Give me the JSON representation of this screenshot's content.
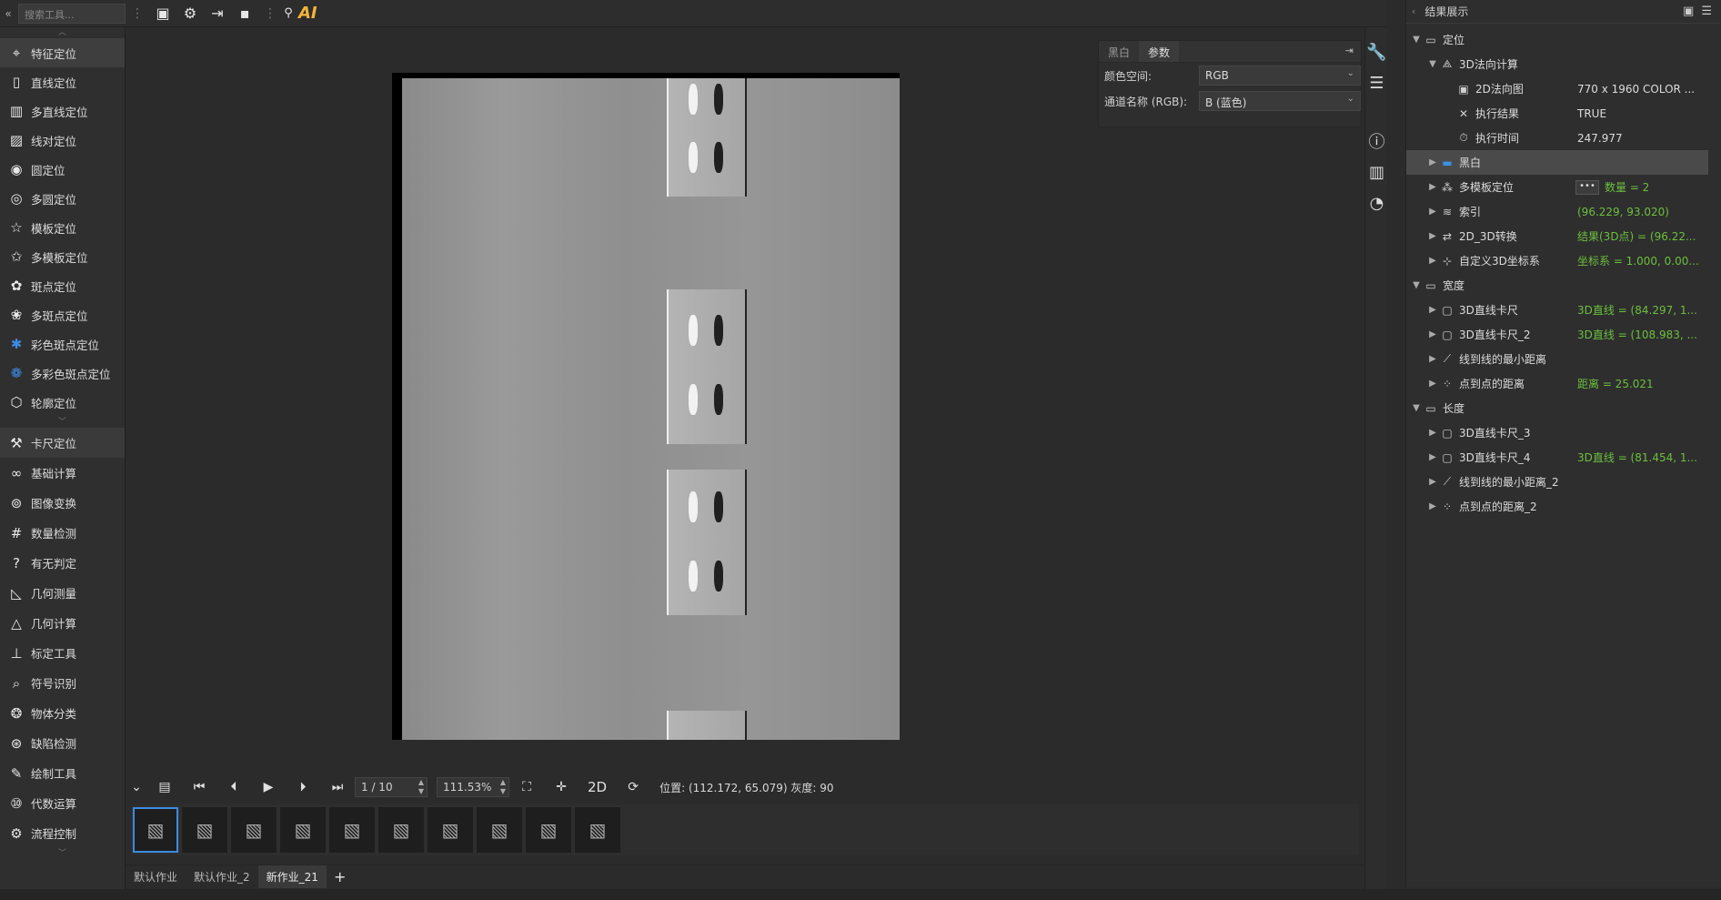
{
  "toolbar": {
    "search_placeholder": "搜索工具...",
    "ai_label": "AI"
  },
  "sidebar": {
    "tools": [
      {
        "label": "特征定位",
        "icon": "location-pin-icon"
      },
      {
        "label": "直线定位",
        "icon": "line-icon"
      },
      {
        "label": "多直线定位",
        "icon": "multi-line-icon"
      },
      {
        "label": "线对定位",
        "icon": "line-pair-icon"
      },
      {
        "label": "圆定位",
        "icon": "circle-icon"
      },
      {
        "label": "多圆定位",
        "icon": "multi-circle-icon"
      },
      {
        "label": "模板定位",
        "icon": "star-icon"
      },
      {
        "label": "多模板定位",
        "icon": "multi-star-icon"
      },
      {
        "label": "斑点定位",
        "icon": "blob-icon"
      },
      {
        "label": "多斑点定位",
        "icon": "multi-blob-icon"
      },
      {
        "label": "彩色斑点定位",
        "icon": "color-blob-icon"
      },
      {
        "label": "多彩色斑点定位",
        "icon": "multi-color-blob-icon"
      },
      {
        "label": "轮廓定位",
        "icon": "contour-icon"
      }
    ],
    "categories": [
      {
        "label": "卡尺定位",
        "icon": "caliper-icon"
      },
      {
        "label": "基础计算",
        "icon": "infinity-icon"
      },
      {
        "label": "图像变换",
        "icon": "transform-icon"
      },
      {
        "label": "数量检测",
        "icon": "count-icon"
      },
      {
        "label": "有无判定",
        "icon": "question-icon"
      },
      {
        "label": "几何测量",
        "icon": "measure-icon"
      },
      {
        "label": "几何计算",
        "icon": "geometry-icon"
      },
      {
        "label": "标定工具",
        "icon": "calibrate-icon"
      },
      {
        "label": "符号识别",
        "icon": "ocr-icon"
      },
      {
        "label": "物体分类",
        "icon": "brain-icon"
      },
      {
        "label": "缺陷检测",
        "icon": "defect-icon"
      },
      {
        "label": "绘制工具",
        "icon": "draw-icon"
      },
      {
        "label": "代数运算",
        "icon": "binary-icon"
      },
      {
        "label": "流程控制",
        "icon": "flow-icon"
      }
    ]
  },
  "params": {
    "tabs": [
      "黑白",
      "参数"
    ],
    "active_tab": 1,
    "rows": [
      {
        "label": "颜色空间:",
        "value": "RGB"
      },
      {
        "label": "通道名称 (RGB):",
        "value": "B (蓝色)"
      }
    ]
  },
  "playback": {
    "frame": "1 / 10",
    "zoom": "111.53%",
    "mode": "2D",
    "status": "位置: (112.172, 65.079)  灰度: 90"
  },
  "thumbnails_count": 10,
  "bottom_tabs": [
    "默认作业",
    "默认作业_2",
    "新作业_21"
  ],
  "active_bottom_tab": 2,
  "results": {
    "title": "结果展示",
    "tree": [
      {
        "level": 0,
        "arrow": "▼",
        "icon": "folder-icon",
        "label": "定位",
        "value": ""
      },
      {
        "level": 1,
        "arrow": "▼",
        "icon": "normal-calc-icon",
        "label": "3D法向计算",
        "value": ""
      },
      {
        "level": 2,
        "arrow": "",
        "icon": "image-icon",
        "label": "2D法向图",
        "value": "770 x 1960 COLOR ..."
      },
      {
        "level": 2,
        "arrow": "",
        "icon": "result-icon",
        "label": "执行结果",
        "value": "TRUE"
      },
      {
        "level": 2,
        "arrow": "",
        "icon": "time-icon",
        "label": "执行时间",
        "value": "247.977"
      },
      {
        "level": 1,
        "arrow": "▶",
        "icon": "bw-icon",
        "label": "黑白",
        "value": "",
        "selected": true
      },
      {
        "level": 1,
        "arrow": "▶",
        "icon": "multi-template-icon",
        "label": "多模板定位",
        "value": "数量 = 2",
        "green": true,
        "button": "•••"
      },
      {
        "level": 1,
        "arrow": "▶",
        "icon": "index-icon",
        "label": "索引",
        "value": "(96.229, 93.020)",
        "green": true
      },
      {
        "level": 1,
        "arrow": "▶",
        "icon": "convert-icon",
        "label": "2D_3D转换",
        "value": "结果(3D点) = (96.22...",
        "green": true
      },
      {
        "level": 1,
        "arrow": "▶",
        "icon": "axis-icon",
        "label": "自定义3D坐标系",
        "value": "坐标系 = 1.000, 0.00...",
        "green": true
      },
      {
        "level": 0,
        "arrow": "▼",
        "icon": "folder-icon",
        "label": "宽度",
        "value": ""
      },
      {
        "level": 1,
        "arrow": "▶",
        "icon": "caliper-3d-icon",
        "label": "3D直线卡尺",
        "value": "3D直线 = (84.297, 1...",
        "green": true
      },
      {
        "level": 1,
        "arrow": "▶",
        "icon": "caliper-3d-icon",
        "label": "3D直线卡尺_2",
        "value": "3D直线 = (108.983, ...",
        "green": true
      },
      {
        "level": 1,
        "arrow": "▶",
        "icon": "line-distance-icon",
        "label": "线到线的最小距离",
        "value": ""
      },
      {
        "level": 1,
        "arrow": "▶",
        "icon": "point-distance-icon",
        "label": "点到点的距离",
        "value": "距离 = 25.021",
        "green": true
      },
      {
        "level": 0,
        "arrow": "▼",
        "icon": "folder-icon",
        "label": "长度",
        "value": ""
      },
      {
        "level": 1,
        "arrow": "▶",
        "icon": "caliper-3d-icon",
        "label": "3D直线卡尺_3",
        "value": ""
      },
      {
        "level": 1,
        "arrow": "▶",
        "icon": "caliper-3d-icon",
        "label": "3D直线卡尺_4",
        "value": "3D直线 = (81.454, 1...",
        "green": true
      },
      {
        "level": 1,
        "arrow": "▶",
        "icon": "line-distance-icon",
        "label": "线到线的最小距离_2",
        "value": ""
      },
      {
        "level": 1,
        "arrow": "▶",
        "icon": "point-distance-icon",
        "label": "点到点的距离_2",
        "value": ""
      }
    ]
  }
}
